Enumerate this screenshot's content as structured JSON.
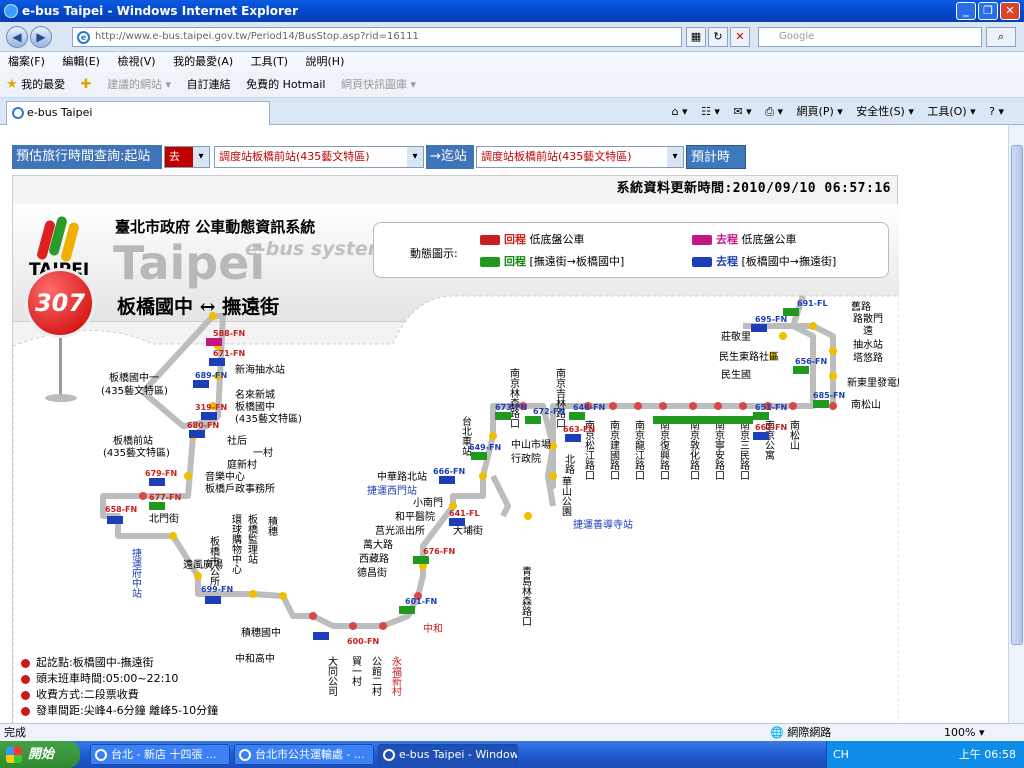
{
  "window": {
    "title": "e-bus Taipei - Windows Internet Explorer"
  },
  "address": {
    "url": "http://www.e-bus.taipei.gov.tw/Period14/BusStop.asp?rid=16111",
    "search_placeholder": "Google"
  },
  "menu": [
    "檔案(F)",
    "編輯(E)",
    "檢視(V)",
    "我的最愛(A)",
    "工具(T)",
    "說明(H)"
  ],
  "favorites": {
    "label": "我的最愛",
    "items": [
      "建議的網站 ▾",
      "自訂連結",
      "免費的 Hotmail",
      "網頁快訊圖庫 ▾"
    ]
  },
  "tab": {
    "label": "e-bus Taipei"
  },
  "commandbar": [
    "網頁(P) ▾",
    "安全性(S) ▾",
    "工具(O) ▾"
  ],
  "form": {
    "label_from": "預估旅行時間查詢:起站",
    "direction": "去程",
    "from_station": "調度站板橋前站(435藝文特區)",
    "arrow_to": "→迄站",
    "to_station": "調度站板橋前站(435藝文特區)",
    "submit": "預計時間"
  },
  "updated": "系統資料更新時間:2010/09/10  06:57:16",
  "header": {
    "city": "臺北市政府  公車動態資訊系統",
    "brand": "Taipei",
    "ebus": "e-bus system",
    "logo_text": "TAIPEI"
  },
  "legend": {
    "title": "動態圖示:",
    "r1": "回程",
    "r1b": "低底盤公車",
    "g1": "去程",
    "g1b": "低底盤公車",
    "r2": "回程",
    "r2b": "[撫遠街→板橋國中]",
    "g2": "去程",
    "g2b": "[板橋國中→撫遠街]"
  },
  "route": {
    "number": "307",
    "name": "板橋國中 ↔ 撫遠街"
  },
  "stations": {
    "s1": "板橋國中一",
    "s1b": "(435藝文特區)",
    "s2": "板橋前站",
    "s2b": "(435藝文特區)",
    "s3": "新海抽水站",
    "s4": "名來新城",
    "s5": "板橋國中",
    "s5b": "(435藝文特區)",
    "s6": "社后",
    "s7": "一村",
    "s8": "庭新村",
    "s9": "音樂中心",
    "s10": "板橋戶政事務所",
    "s11": "北門街",
    "s12": "遠風廣場",
    "s13": "板橋市公所",
    "s14": "捷運府中站",
    "s15": "環球購物中心",
    "s16": "板橋監理站",
    "s17": "積穗",
    "s18": "積穗國中",
    "s19": "中和高中",
    "s20": "大同公司",
    "s21": "貿一村",
    "s22": "公館二村",
    "s23": "永福新村",
    "s24": "中和",
    "s25": "萬大路",
    "s26": "西藏路",
    "s27": "德昌街",
    "s28": "莒光派出所",
    "s29": "和平醫院",
    "s30": "小南門",
    "s31": "捷運西門站",
    "s32": "中華路北站",
    "s33": "大埔街",
    "s34": "台北車站",
    "s35": "中山市場",
    "s36": "行政院",
    "s37": "青島林森路口",
    "s38": "南京林森路口",
    "s39": "南京吉林路口",
    "s40": "捷運善導寺站",
    "s41": "華山公園",
    "s42": "北路",
    "s43": "南京松江路口",
    "s44": "南京建國路口",
    "s45": "南京龍江路口",
    "s46": "南京復興路口",
    "s47": "南京敦化路口",
    "s48": "南京寧安路口",
    "s49": "南京三民路口",
    "s50": "南京公寓",
    "s51": "南松山",
    "s52": "南松山",
    "s53": "新東里發電所",
    "s54": "塔悠路",
    "s55": "抽水站",
    "s56": "民生國",
    "s57": "民生東路社區",
    "s58": "莊敬里",
    "s59": "遠",
    "s60": "舊路",
    "s61": "路散門"
  },
  "bus_labels": [
    "588-FN",
    "671-FN",
    "689-FN",
    "319-FN",
    "680-FN",
    "679-FN",
    "677-FN",
    "658-FN",
    "699-FN",
    "672-FN",
    "649-FN",
    "666-FN",
    "641-FL",
    "673-FN",
    "648-FN",
    "663-FN",
    "656-FN",
    "691-FL",
    "695-FN",
    "685-FN",
    "651-FN",
    "662-FN",
    "676-FN",
    "601-FN",
    "600-FN"
  ],
  "info": [
    "起訖點:板橋國中-撫遠街",
    "頭末班車時間:05:00~22:10",
    "收費方式:二段票收費",
    "發車間距:尖峰4-6分鐘  離峰5-10分鐘"
  ],
  "status": {
    "left": "完成",
    "zone": "網際網路",
    "zoom": "100% ▾"
  },
  "taskbar": {
    "start": "開始",
    "tasks": [
      "台北 - 新店 十四張 ...",
      "台北市公共運輸處 - ...",
      "e-bus Taipei - Window..."
    ],
    "lang": "CH",
    "clock": "上午 06:58"
  }
}
